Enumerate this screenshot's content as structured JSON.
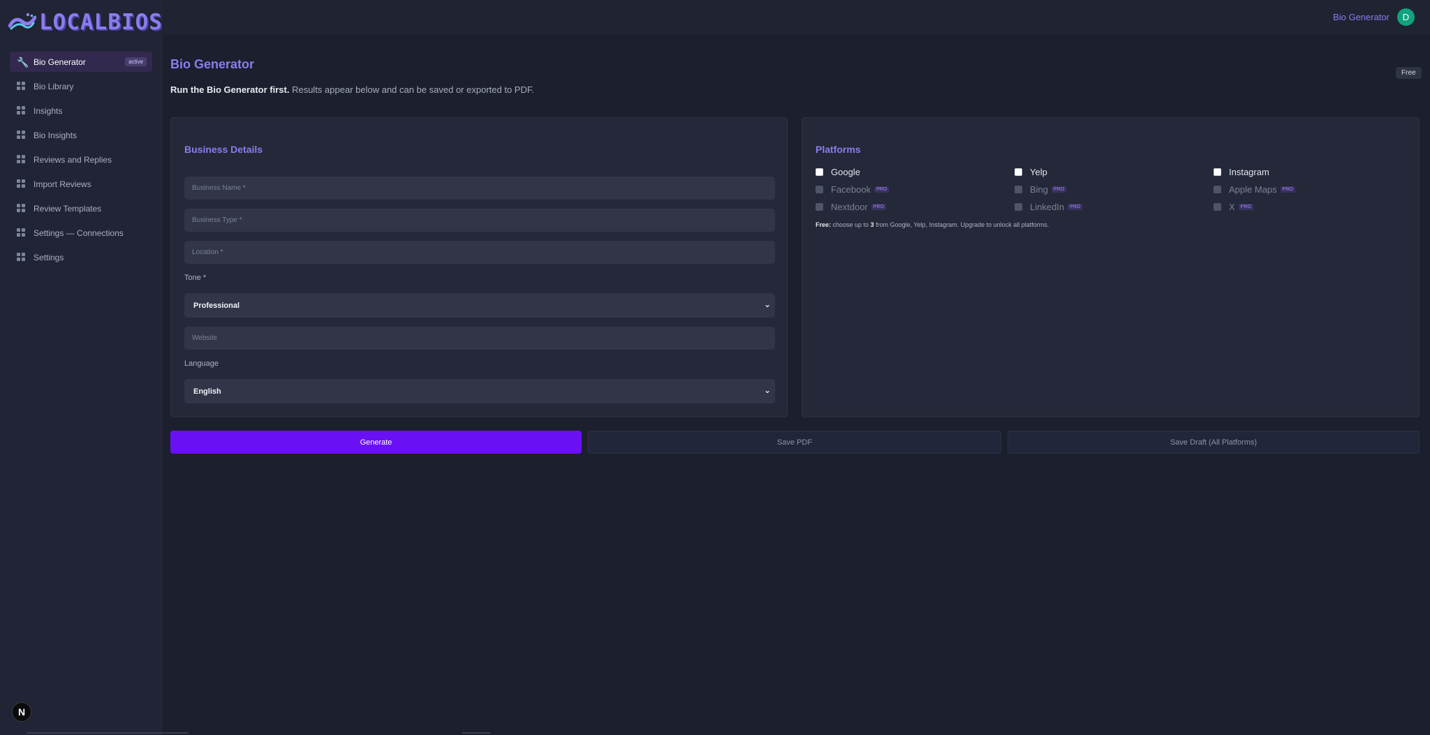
{
  "brand": {
    "name": "LOCALBIOS"
  },
  "colors": {
    "accent": "#8c7cf0",
    "primary_button": "#6a10f5",
    "avatar": "#10a37f"
  },
  "sidebar": {
    "items": [
      {
        "label": "Bio Generator",
        "icon": "wrench-icon",
        "active": true,
        "badge": "active"
      },
      {
        "label": "Bio Library",
        "icon": "grid-icon"
      },
      {
        "label": "Insights",
        "icon": "grid-icon"
      },
      {
        "label": "Bio Insights",
        "icon": "grid-icon"
      },
      {
        "label": "Reviews and Replies",
        "icon": "grid-icon"
      },
      {
        "label": "Import Reviews",
        "icon": "grid-icon"
      },
      {
        "label": "Review Templates",
        "icon": "grid-icon"
      },
      {
        "label": "Settings — Connections",
        "icon": "grid-icon"
      },
      {
        "label": "Settings",
        "icon": "grid-icon"
      }
    ],
    "next_badge": "N"
  },
  "topbar": {
    "title": "Bio Generator",
    "avatar_initial": "D"
  },
  "page": {
    "title": "Bio Generator",
    "subtitle_bold": "Run the Bio Generator first.",
    "subtitle_rest": " Results appear below and can be saved or exported to PDF.",
    "plan": "Free"
  },
  "business": {
    "title": "Business Details",
    "name_placeholder": "Business Name *",
    "type_placeholder": "Business Type *",
    "location_placeholder": "Location *",
    "tone_label": "Tone *",
    "tone_value": "Professional",
    "website_placeholder": "Website",
    "language_label": "Language",
    "language_value": "English"
  },
  "platforms": {
    "title": "Platforms",
    "items": [
      {
        "label": "Google",
        "pro": false
      },
      {
        "label": "Yelp",
        "pro": false
      },
      {
        "label": "Instagram",
        "pro": false
      },
      {
        "label": "Facebook",
        "pro": true
      },
      {
        "label": "Bing",
        "pro": true
      },
      {
        "label": "Apple Maps",
        "pro": true
      },
      {
        "label": "Nextdoor",
        "pro": true
      },
      {
        "label": "LinkedIn",
        "pro": true
      },
      {
        "label": "X",
        "pro": true
      }
    ],
    "pro_tag": "PRO",
    "note_bold": "Free:",
    "note_a": " choose up to ",
    "note_count": "3",
    "note_b": " from Google, Yelp, Instagram. Upgrade to unlock all platforms."
  },
  "actions": {
    "generate": "Generate",
    "save_pdf": "Save PDF",
    "save_draft": "Save Draft (All Platforms)"
  }
}
